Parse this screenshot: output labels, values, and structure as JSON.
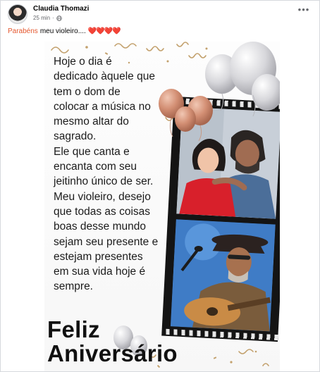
{
  "post": {
    "author": "Claudia Thomazi",
    "time": "25 min",
    "more_icon": "more-horizontal-icon",
    "caption": {
      "highlight": "Parabéns",
      "text": "meu violeiro....",
      "emoji": "❤️❤️❤️❤️",
      "emoji_count": 4
    }
  },
  "image": {
    "message_lines": [
      "Hoje o dia é",
      "dedicado àquele que",
      "tem o dom de",
      "colocar a música no",
      "mesmo altar do",
      "sagrado.",
      "Ele que canta e",
      "encanta com seu",
      "jeitinho único de ser.",
      "Meu  violeiro,  desejo",
      "que todas as coisas",
      "boas desse mundo",
      "sejam seu presente e",
      "estejam presentes",
      "em sua vida hoje é",
      "sempre."
    ],
    "title_line1": "Feliz",
    "title_line2": "Aniversário",
    "colors": {
      "heart": "#e0245e",
      "highlight": "#e4572e",
      "balloon_rose": "#d38f74",
      "balloon_silver": "#cfcfd3"
    }
  }
}
